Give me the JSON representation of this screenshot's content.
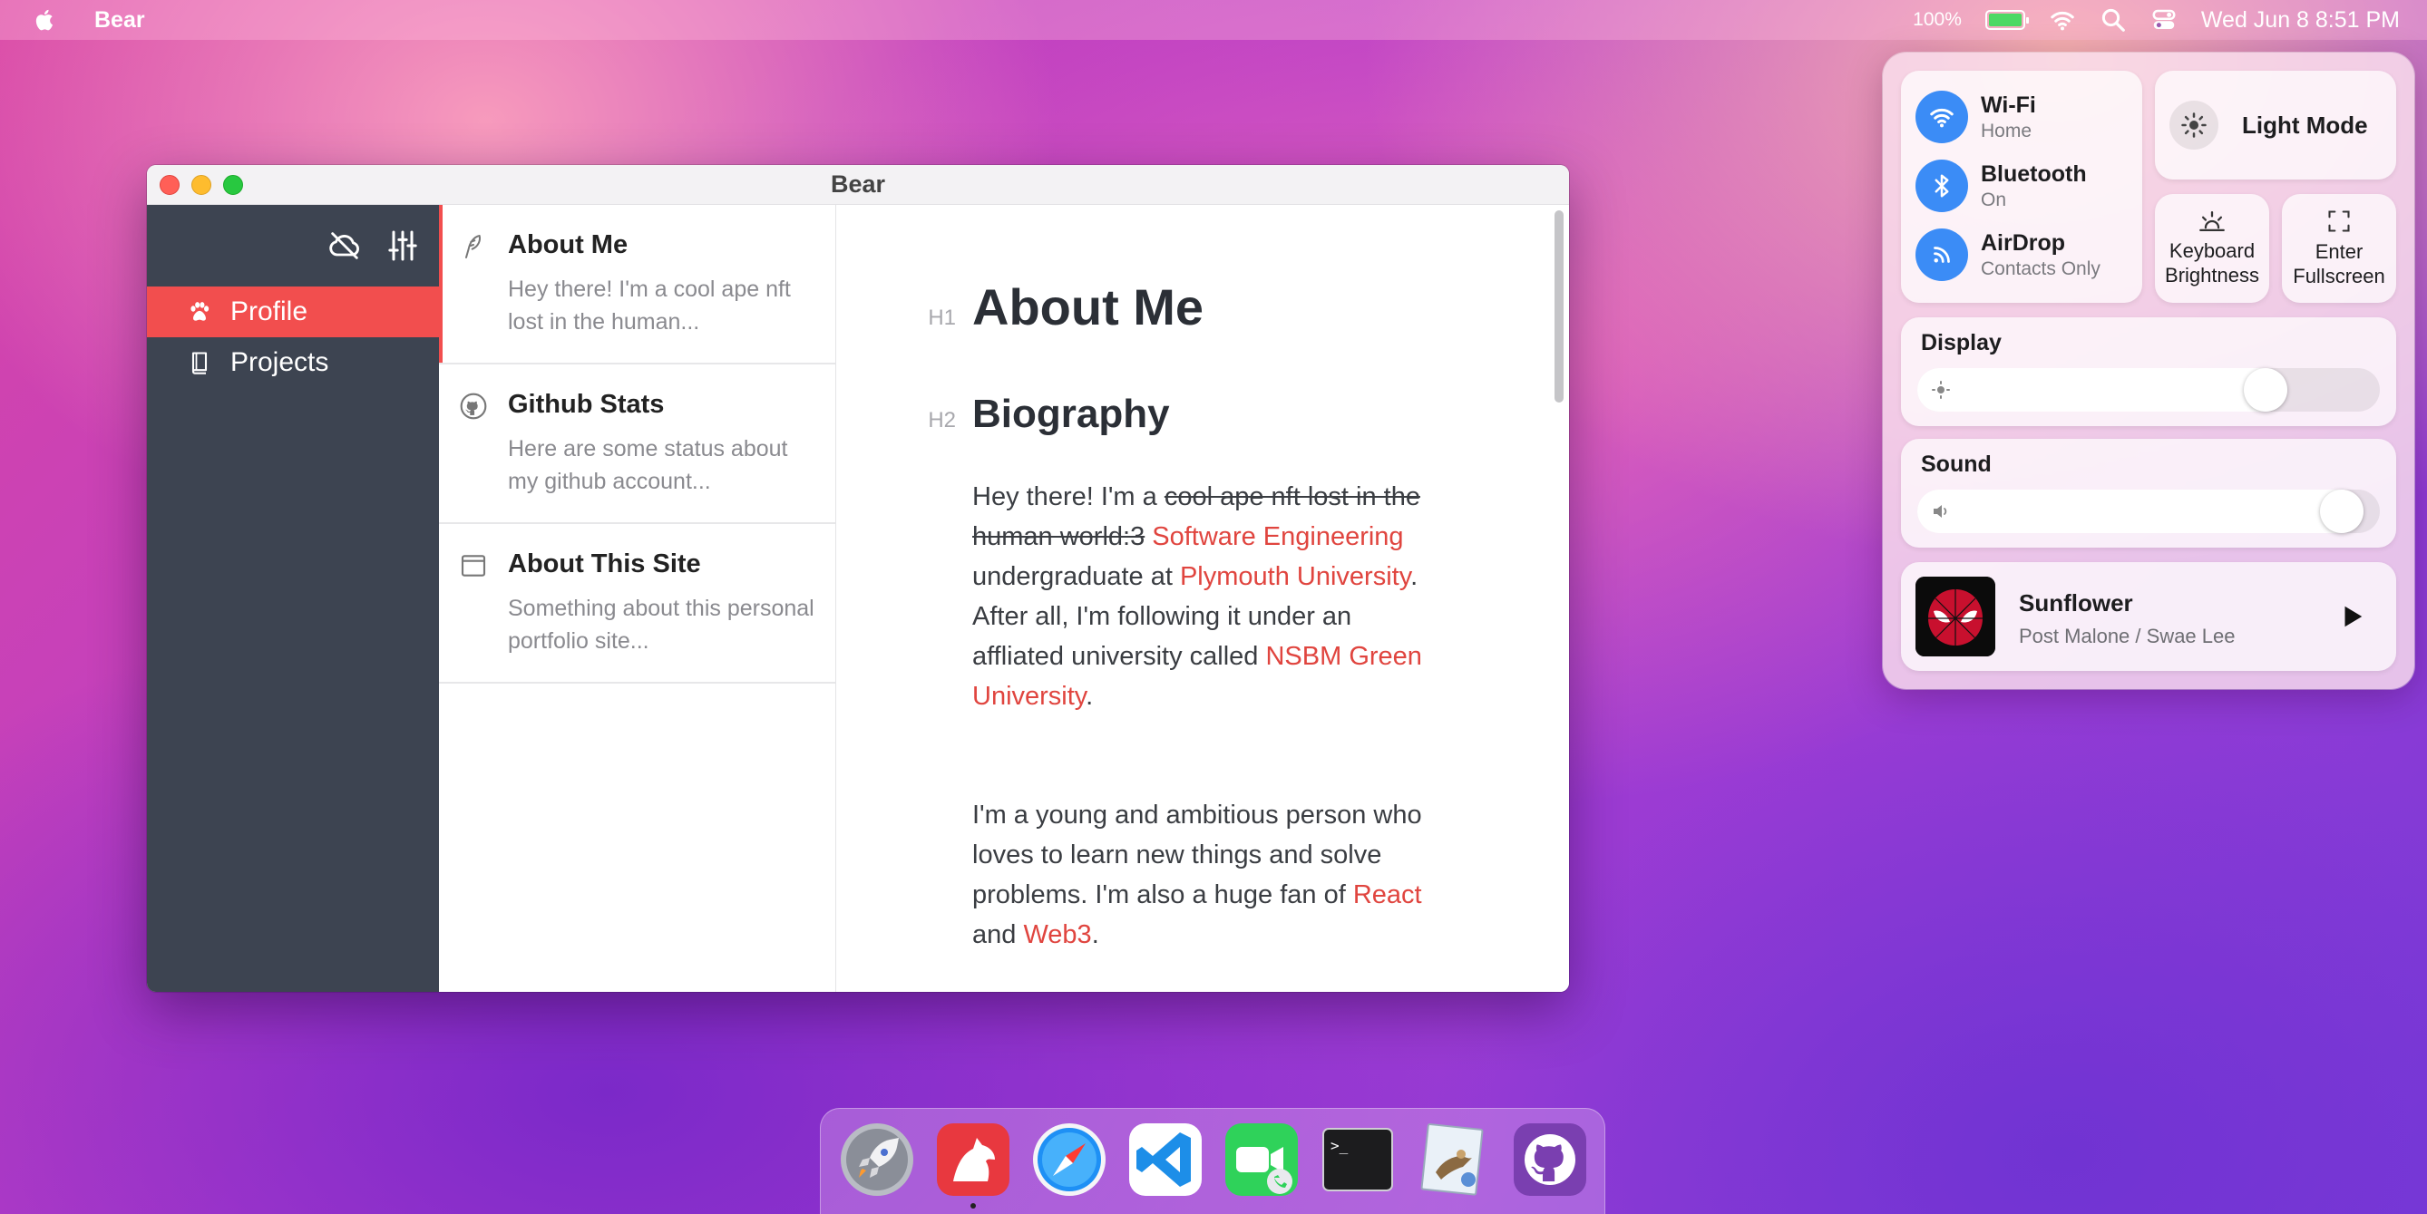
{
  "menubar": {
    "app_name": "Bear",
    "battery_pct": "100%",
    "clock": "Wed Jun 8  8:51 PM",
    "icons": [
      "apple-logo",
      "battery-charging-icon",
      "wifi-icon",
      "spotlight-search-icon",
      "control-center-icon"
    ]
  },
  "window": {
    "title": "Bear",
    "sidebar": {
      "items": [
        {
          "label": "Profile",
          "icon": "paw-icon",
          "active": true
        },
        {
          "label": "Projects",
          "icon": "book-icon",
          "active": false
        }
      ],
      "toolbar_icons": [
        "cloud-off-icon",
        "sliders-icon"
      ]
    },
    "notes": [
      {
        "title": "About Me",
        "preview": "Hey there! I'm a cool ape nft lost in the human...",
        "icon": "feather-icon",
        "active": true
      },
      {
        "title": "Github Stats",
        "preview": "Here are some status about my github account...",
        "icon": "github-icon",
        "active": false
      },
      {
        "title": "About This Site",
        "preview": "Something about this personal portfolio site...",
        "icon": "browser-window-icon",
        "active": false
      }
    ],
    "editor": {
      "h1_marker": "H1",
      "h1": "About Me",
      "h2_marker": "H2",
      "h2": "Biography",
      "p1": {
        "t1": "Hey there! I'm a ",
        "strike": "cool ape nft lost in the human world:3",
        "link1": "Software Engineering",
        "t2": " undergraduate at ",
        "link2": "Plymouth University",
        "t3": ". After all, I'm following it under an affliated university called ",
        "link3": "NSBM Green University",
        "t4": "."
      },
      "p2": {
        "t1": "I'm a young and ambitious person who loves to learn new things and solve problems. I'm also a huge fan of ",
        "link1": "React",
        "t2": " and ",
        "link2": "Web3",
        "t3": "."
      }
    }
  },
  "control_center": {
    "network": [
      {
        "name": "Wi-Fi",
        "status": "Home",
        "icon": "wifi-icon"
      },
      {
        "name": "Bluetooth",
        "status": "On",
        "icon": "bluetooth-icon"
      },
      {
        "name": "AirDrop",
        "status": "Contacts Only",
        "icon": "airdrop-icon"
      }
    ],
    "light_mode": "Light Mode",
    "keyboard_brightness": "Keyboard Brightness",
    "enter_fullscreen": "Enter Fullscreen",
    "display": {
      "label": "Display",
      "level_pct": 78
    },
    "sound": {
      "label": "Sound",
      "level_pct": 96
    },
    "now_playing": {
      "title": "Sunflower",
      "artist": "Post Malone / Swae Lee"
    }
  },
  "dock": {
    "apps": [
      "Launchpad",
      "Bear",
      "Safari",
      "VS Code",
      "FaceTime",
      "Terminal",
      "Mail",
      "GitHub"
    ]
  },
  "colors": {
    "accent": "#f24e4e",
    "link": "#e0453f",
    "sidebar": "#3d4451",
    "blue": "#3b8cf6"
  }
}
